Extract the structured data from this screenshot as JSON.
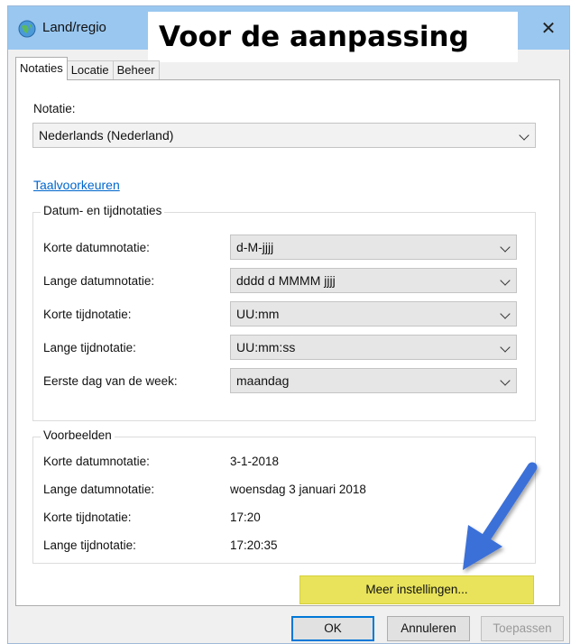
{
  "window": {
    "title": "Land/regio"
  },
  "banner": {
    "text": "Voor de aanpassing"
  },
  "tabs": [
    {
      "label": "Notaties",
      "active": true
    },
    {
      "label": "Locatie",
      "active": false
    },
    {
      "label": "Beheer",
      "active": false
    }
  ],
  "notatie": {
    "label": "Notatie:",
    "value": "Nederlands (Nederland)"
  },
  "language_link": "Taalvoorkeuren",
  "datetime": {
    "group_title": "Datum- en tijdnotaties",
    "rows": [
      {
        "label": "Korte datumnotatie:",
        "value": "d-M-jjjj"
      },
      {
        "label": "Lange datumnotatie:",
        "value": "dddd d MMMM jjjj"
      },
      {
        "label": "Korte tijdnotatie:",
        "value": "UU:mm"
      },
      {
        "label": "Lange tijdnotatie:",
        "value": "UU:mm:ss"
      },
      {
        "label": "Eerste dag van de week:",
        "value": "maandag"
      }
    ]
  },
  "examples": {
    "group_title": "Voorbeelden",
    "rows": [
      {
        "label": "Korte datumnotatie:",
        "value": "3-1-2018"
      },
      {
        "label": "Lange datumnotatie:",
        "value": "woensdag 3 januari 2018"
      },
      {
        "label": "Korte tijdnotatie:",
        "value": "17:20"
      },
      {
        "label": "Lange tijdnotatie:",
        "value": "17:20:35"
      }
    ]
  },
  "buttons": {
    "more_settings": "Meer instellingen...",
    "ok": "OK",
    "cancel": "Annuleren",
    "apply": "Toepassen"
  },
  "colors": {
    "titlebar": "#99c7f0",
    "highlight": "#e8e35a",
    "arrow": "#3b6fd8",
    "link": "#0066cc"
  },
  "icons": {
    "title": "globe-icon",
    "close": "close-icon",
    "chevron": "chevron-down-icon",
    "annotation": "arrow-annotation"
  }
}
